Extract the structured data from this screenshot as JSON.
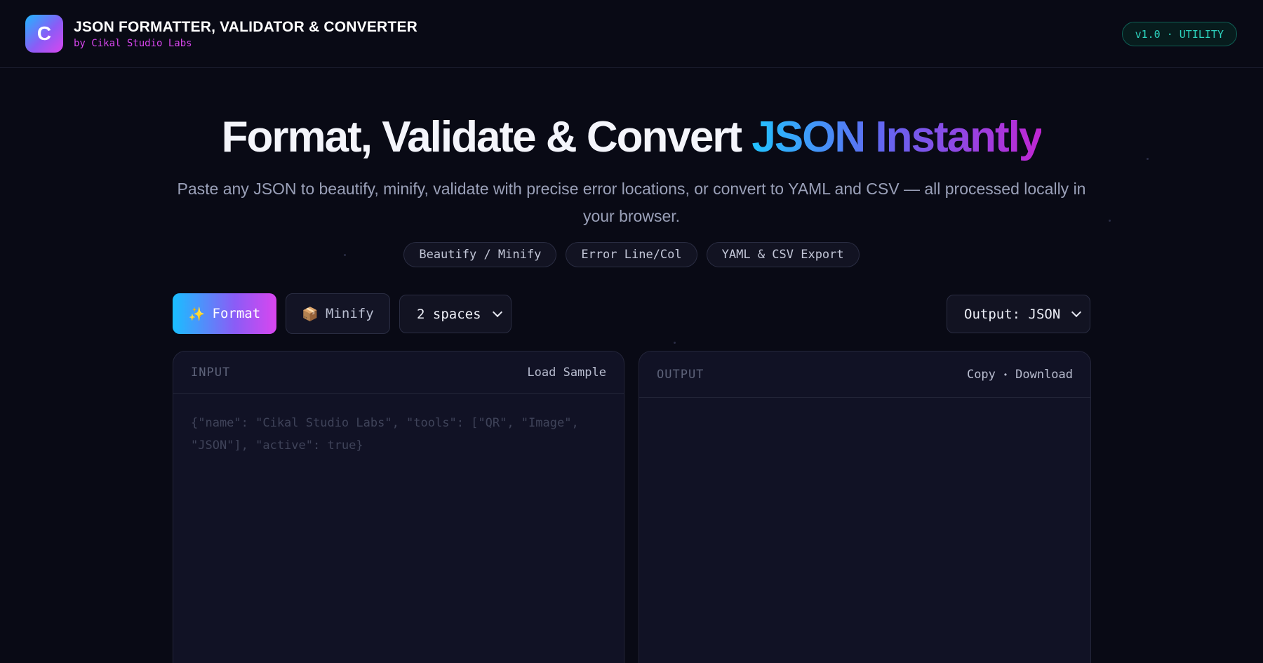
{
  "header": {
    "logo_letter": "C",
    "title": "JSON FORMATTER, VALIDATOR & CONVERTER",
    "subtitle": "by Cikal Studio Labs",
    "version": "v1.0 · UTILITY"
  },
  "hero": {
    "title_plain": "Format, Validate & Convert ",
    "title_highlight": "JSON Instantly",
    "description": "Paste any JSON to beautify, minify, validate with precise error locations, or convert to YAML and CSV — all processed locally in your browser.",
    "chips": [
      "Beautify / Minify",
      "Error Line/Col",
      "YAML & CSV Export"
    ]
  },
  "toolbar": {
    "format_icon": "✨",
    "format_label": "Format",
    "minify_icon": "📦",
    "minify_label": "Minify",
    "indent_value": "2 spaces",
    "output_value": "Output: JSON"
  },
  "input_panel": {
    "label": "INPUT",
    "action": "Load Sample",
    "placeholder": "{\"name\": \"Cikal Studio Labs\", \"tools\": [\"QR\", \"Image\", \"JSON\"], \"active\": true}"
  },
  "output_panel": {
    "label": "OUTPUT",
    "copy_label": "Copy",
    "separator": "•",
    "download_label": "Download"
  },
  "colors": {
    "background": "#090a15",
    "accent_cyan": "#22c3ff",
    "accent_purple": "#8b5cf6",
    "accent_magenta": "#d946ef",
    "badge_teal": "#2dd4bf"
  }
}
